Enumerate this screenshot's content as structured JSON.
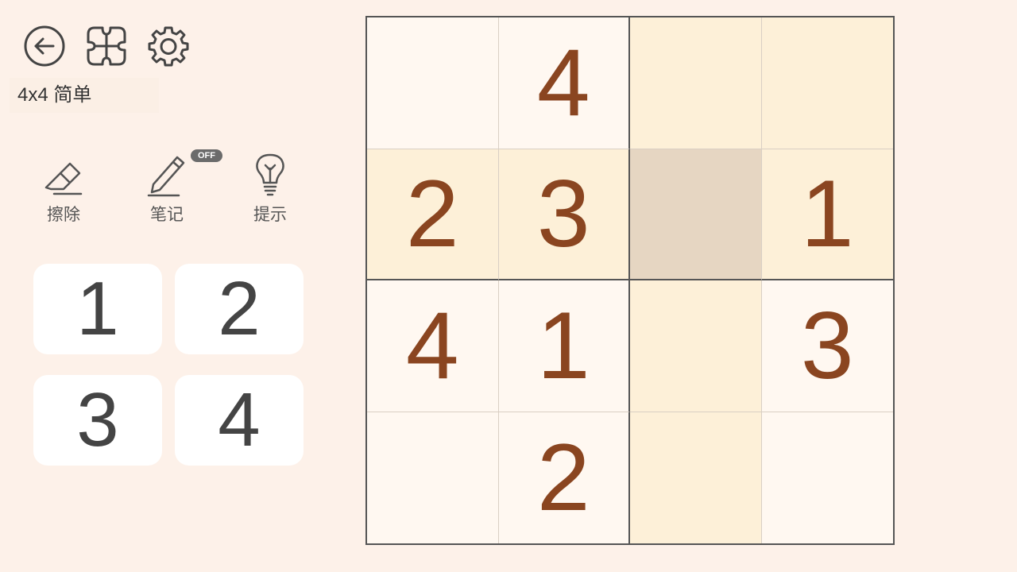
{
  "toolbar": {
    "back_icon": "back-arrow-icon",
    "levels_icon": "puzzle-grid-icon",
    "settings_icon": "gear-icon"
  },
  "level_label": "4x4 简单",
  "tools": {
    "erase_label": "擦除",
    "notes_label": "笔记",
    "notes_badge": "OFF",
    "hint_label": "提示"
  },
  "numpad": [
    "1",
    "2",
    "3",
    "4"
  ],
  "board": {
    "size": 4,
    "cells": [
      [
        "",
        "4",
        "",
        ""
      ],
      [
        "2",
        "3",
        "",
        "1"
      ],
      [
        "4",
        "1",
        "",
        "3"
      ],
      [
        "",
        "2",
        "",
        ""
      ]
    ],
    "selected": [
      1,
      2
    ],
    "colors": {
      "digit": "#8a4520",
      "highlight": "#fdf0d8",
      "selected": "#e6d6c2",
      "base": "#fff8f1"
    }
  }
}
